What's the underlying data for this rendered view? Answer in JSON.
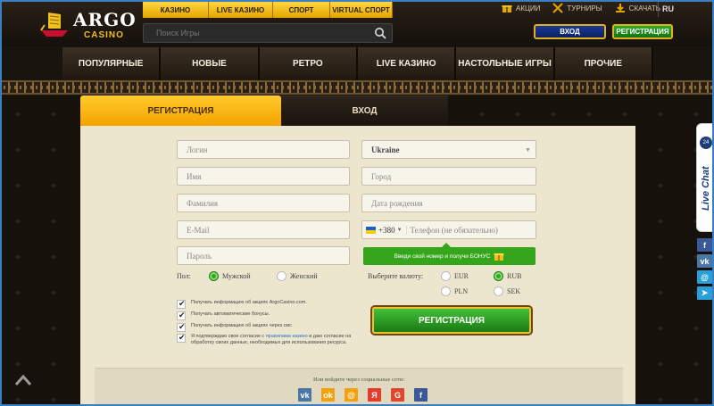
{
  "logo": {
    "name": "ARGO",
    "sub": "CASINO"
  },
  "game_tabs": [
    "КАЗИНО",
    "LIVE КАЗИНО",
    "СПОРТ",
    "VIRTUAL СПОРТ"
  ],
  "search": {
    "placeholder": "Поиск Игры"
  },
  "top_links": [
    {
      "label": "АКЦИИ",
      "icon": "gift-icon"
    },
    {
      "label": "ТУРНИРЫ",
      "icon": "swords-icon"
    },
    {
      "label": "СКАЧАТЬ",
      "icon": "download-icon"
    }
  ],
  "language": "RU",
  "header_buttons": {
    "login": "ВХОД",
    "register": "РЕГИСТРАЦИЯ"
  },
  "nav": [
    "ПОПУЛЯРНЫЕ",
    "НОВЫЕ",
    "РЕТРО",
    "LIVE КАЗИНО",
    "НАСТОЛЬНЫЕ ИГРЫ",
    "ПРОЧИЕ"
  ],
  "form_tabs": {
    "register": "РЕГИСТРАЦИЯ",
    "login": "ВХОД"
  },
  "form": {
    "login_placeholder": "Логин",
    "name_placeholder": "Имя",
    "surname_placeholder": "Фамилия",
    "email_placeholder": "E-Mail",
    "password_placeholder": "Пароль",
    "country": "Ukraine",
    "city_placeholder": "Город",
    "birthdate_placeholder": "Дата рождения",
    "phone_code": "+380",
    "phone_placeholder": "Телефон (не обязательно)",
    "bonus_text": "Введи свой номер и получи БОНУС",
    "gender_label": "Пол:",
    "gender_male": "Мужской",
    "gender_female": "Женский",
    "gender_selected": "male",
    "currency_label": "Выберите валюту:",
    "currencies": [
      "EUR",
      "RUB",
      "PLN",
      "SEK"
    ],
    "currency_selected": "RUB",
    "checks": [
      {
        "text": "Получать информацию об акциях ArgoCasino.com."
      },
      {
        "text": "Получать автоматические бонусы."
      },
      {
        "text": "Получать информацию об акциях через смс"
      },
      {
        "text_before": "Я подтверждаю свое согласие с ",
        "link": "правилами казино",
        "text_after": " и даю согласие на обработку своих данных, необходимых для использования ресурса."
      }
    ],
    "submit": "РЕГИСТРАЦИЯ"
  },
  "social": {
    "title": "Или войдите через социальные сети:",
    "icons": [
      {
        "name": "vk-icon",
        "glyph": "vk",
        "color": "#4a76a8"
      },
      {
        "name": "odnoklassniki-icon",
        "glyph": "ok",
        "color": "#f2a10e"
      },
      {
        "name": "mailru-icon",
        "glyph": "@",
        "color": "#f2a10e"
      },
      {
        "name": "yandex-icon",
        "glyph": "Я",
        "color": "#e53b2c"
      },
      {
        "name": "google-icon",
        "glyph": "G",
        "color": "#e0452d"
      },
      {
        "name": "facebook-icon",
        "glyph": "f",
        "color": "#3b5998"
      }
    ]
  },
  "live_chat": {
    "label": "Live Chat",
    "badge": "24"
  },
  "side_social": [
    {
      "name": "facebook-icon",
      "glyph": "f",
      "color": "#3b5998"
    },
    {
      "name": "vk-icon",
      "glyph": "vk",
      "color": "#4a76a8"
    },
    {
      "name": "mail-icon",
      "glyph": "@",
      "color": "#2aa0d8"
    },
    {
      "name": "telegram-icon",
      "glyph": "➤",
      "color": "#2aa0d8"
    }
  ],
  "colors": {
    "accent_gold": "#f3a300",
    "accent_green": "#2eaa20",
    "panel": "#ece6cf",
    "link": "#2f6ec8"
  }
}
